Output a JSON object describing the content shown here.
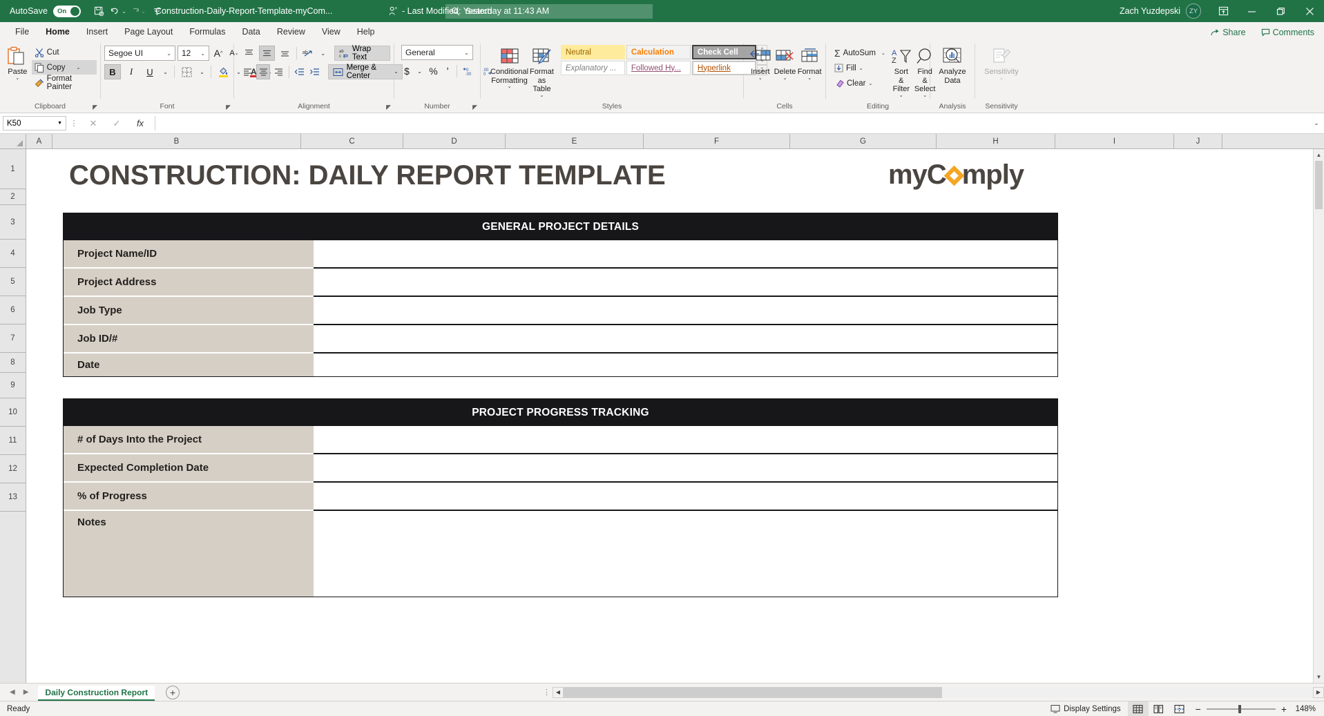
{
  "titlebar": {
    "autosave_label": "AutoSave",
    "autosave_state": "On",
    "filename": "Construction-Daily-Report-Template-myCom...",
    "separator": "-",
    "last_modified": "Last Modified: Yesterday at 11:43 AM",
    "search_placeholder": "Search",
    "user_name": "Zach Yuzdepski",
    "user_initials": "ZY",
    "quick_access": [
      "save-icon",
      "undo-icon",
      "redo-icon",
      "customize-qat-icon"
    ],
    "window_buttons": [
      "ribbon-display-options-icon",
      "minimize-icon",
      "restore-icon",
      "close-icon"
    ]
  },
  "tabs": {
    "items": [
      "File",
      "Home",
      "Insert",
      "Page Layout",
      "Formulas",
      "Data",
      "Review",
      "View",
      "Help"
    ],
    "active": "Home",
    "share_label": "Share",
    "comments_label": "Comments"
  },
  "ribbon": {
    "groups": [
      {
        "name": "Clipboard"
      },
      {
        "name": "Font"
      },
      {
        "name": "Alignment"
      },
      {
        "name": "Number"
      },
      {
        "name": "Styles"
      },
      {
        "name": "Cells"
      },
      {
        "name": "Editing"
      },
      {
        "name": "Analysis"
      },
      {
        "name": "Sensitivity"
      }
    ],
    "clipboard": {
      "paste_label": "Paste",
      "cut_label": "Cut",
      "copy_label": "Copy",
      "format_painter_label": "Format Painter"
    },
    "font": {
      "font_family": "Segoe UI",
      "font_size": "12",
      "bold_label": "B",
      "italic_label": "I",
      "underline_label": "U",
      "grow_font_label": "A",
      "shrink_font_label": "A"
    },
    "alignment": {
      "wrap_text_label": "Wrap Text",
      "merge_center_label": "Merge & Center"
    },
    "number": {
      "format": "General",
      "currency_label": "$",
      "percent_label": "%",
      "comma_label": "’"
    },
    "styles": {
      "conditional_formatting_label": "Conditional Formatting",
      "format_as_table_label": "Format as Table",
      "gallery": [
        [
          "Neutral",
          "Calculation",
          "Check Cell"
        ],
        [
          "Explanatory ...",
          "Followed Hy...",
          "Hyperlink"
        ]
      ]
    },
    "cells": {
      "insert_label": "Insert",
      "delete_label": "Delete",
      "format_label": "Format"
    },
    "editing": {
      "autosum_label": "AutoSum",
      "fill_label": "Fill",
      "clear_label": "Clear",
      "sort_filter_label": "Sort & Filter",
      "find_select_label": "Find & Select"
    },
    "analysis": {
      "analyze_data_label": "Analyze Data"
    },
    "sensitivity": {
      "sensitivity_label": "Sensitivity"
    }
  },
  "formulabar": {
    "name_box": "K50",
    "cancel_label": "✕",
    "enter_label": "✓",
    "function_label": "fx",
    "value": ""
  },
  "grid": {
    "columns": [
      "A",
      "B",
      "C",
      "D",
      "E",
      "F",
      "G",
      "H",
      "I",
      "J"
    ],
    "rows": [
      "1",
      "2",
      "3",
      "4",
      "5",
      "6",
      "7",
      "8",
      "9",
      "10",
      "11",
      "12",
      "13"
    ],
    "sheet_title": "CONSTRUCTION: DAILY REPORT TEMPLATE",
    "logo": {
      "pre": "myC",
      "post": "mply"
    },
    "sections": [
      {
        "banner": "GENERAL PROJECT DETAILS",
        "fields": [
          {
            "label": "Project Name/ID",
            "value": ""
          },
          {
            "label": "Project Address",
            "value": ""
          },
          {
            "label": "Job Type",
            "value": ""
          },
          {
            "label": "Job ID/#",
            "value": ""
          },
          {
            "label": "Date",
            "value": ""
          }
        ]
      },
      {
        "banner": "PROJECT PROGRESS TRACKING",
        "fields": [
          {
            "label": "# of Days Into the Project",
            "value": ""
          },
          {
            "label": "Expected Completion Date",
            "value": ""
          },
          {
            "label": "% of Progress",
            "value": ""
          },
          {
            "label": "Notes",
            "value": ""
          }
        ]
      }
    ]
  },
  "sheettabs": {
    "active_sheet": "Daily Construction Report",
    "add_sheet_label": "+"
  },
  "statusbar": {
    "status": "Ready",
    "display_settings": "Display Settings",
    "zoom": "148%",
    "zoom_out": "−",
    "zoom_in": "+",
    "views": [
      "normal-view-icon",
      "page-layout-view-icon",
      "page-break-preview-icon"
    ]
  },
  "colors": {
    "accent_green": "#217346",
    "banner_black": "#17171a",
    "label_tan": "#d5cfc6",
    "logo_orange": "#f5a623",
    "title_brown": "#4a4540"
  }
}
